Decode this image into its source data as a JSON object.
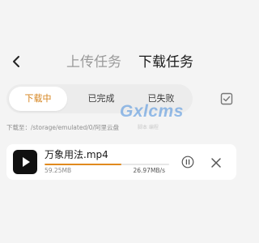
{
  "header": {
    "tabs": [
      {
        "label": "上传任务",
        "active": false
      },
      {
        "label": "下载任务",
        "active": true
      }
    ]
  },
  "filters": {
    "items": [
      {
        "label": "下载中",
        "active": true
      },
      {
        "label": "已完成",
        "active": false
      },
      {
        "label": "已失败",
        "active": false
      }
    ]
  },
  "path": {
    "text": "下载至：/storage/emulated/0/阿里云盘"
  },
  "watermark": {
    "logo": "Gxlcms",
    "subtitle": "脚本 编程"
  },
  "download": {
    "file_name": "万象用法.mp4",
    "size": "59.25MB",
    "speed": "26.97MB/s",
    "progress_percent": 62
  },
  "colors": {
    "accent": "#d5821a",
    "progress": "#e08a1e",
    "background": "#f4f4f4",
    "card": "#ffffff"
  },
  "icons": {
    "back": "chevron-left-icon",
    "select_all": "checkbox-icon",
    "thumb": "play-icon",
    "pause": "pause-circle-icon",
    "close": "close-icon"
  }
}
